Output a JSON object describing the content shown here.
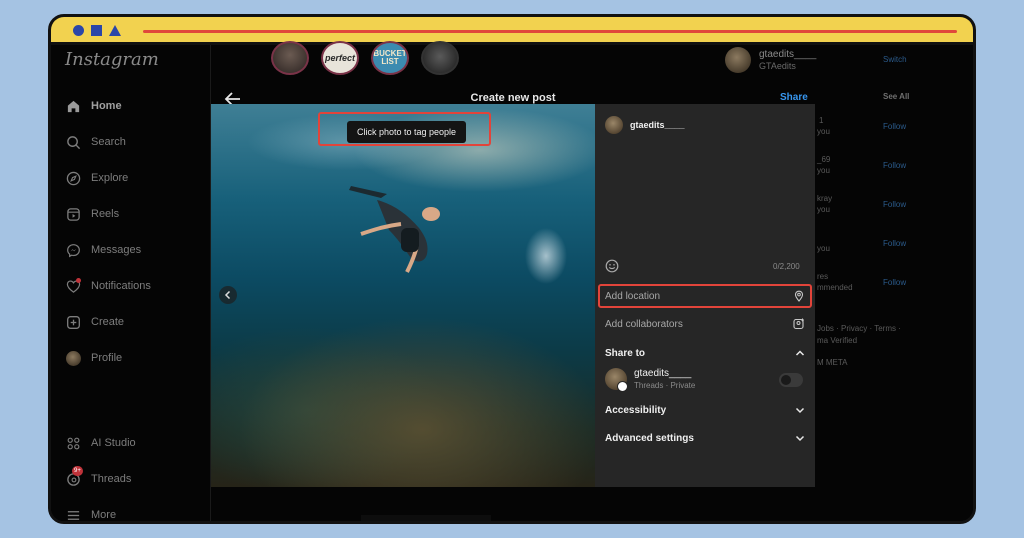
{
  "app": {
    "logo": "Instagram"
  },
  "sidebar": {
    "items": [
      {
        "label": "Home",
        "icon": "home-icon"
      },
      {
        "label": "Search",
        "icon": "search-icon"
      },
      {
        "label": "Explore",
        "icon": "compass-icon"
      },
      {
        "label": "Reels",
        "icon": "reels-icon"
      },
      {
        "label": "Messages",
        "icon": "messenger-icon"
      },
      {
        "label": "Notifications",
        "icon": "heart-icon"
      },
      {
        "label": "Create",
        "icon": "plus-square-icon"
      },
      {
        "label": "Profile",
        "icon": "avatar"
      }
    ],
    "bottom_items": [
      {
        "label": "AI Studio",
        "icon": "ai-studio-icon"
      },
      {
        "label": "Threads",
        "icon": "threads-icon",
        "badge": "9+"
      },
      {
        "label": "More",
        "icon": "menu-icon"
      }
    ]
  },
  "stories": [
    {
      "label": ""
    },
    {
      "label": "perfect"
    },
    {
      "label": "BUCKET LIST"
    },
    {
      "label": ""
    }
  ],
  "right_column": {
    "username": "gtaedits____",
    "subtitle": "GTAedits",
    "switch_label": "Switch",
    "see_all": "See All",
    "fragments": [
      "1",
      "you",
      "_69",
      "you",
      "kray",
      "you",
      "you",
      "res",
      "mmended"
    ],
    "follow_label": "Follow",
    "footer1": "Jobs · Privacy · Terms ·",
    "footer2": "ma Verified",
    "footer3": "M META"
  },
  "modal": {
    "title": "Create new post",
    "share_label": "Share",
    "tooltip": "Click photo to tag people",
    "panel": {
      "username": "gtaedits____",
      "char_count": "0/2,200",
      "add_location": "Add location",
      "add_collaborators": "Add collaborators",
      "share_to": "Share to",
      "threads_name": "gtaedits____",
      "threads_sub": "Threads · Private",
      "accessibility": "Accessibility",
      "advanced_settings": "Advanced settings"
    }
  },
  "colors": {
    "accent_blue": "#3897f0",
    "highlight_red": "#e2443a",
    "frame_yellow": "#f2d24f",
    "background": "#a5c3e3"
  }
}
